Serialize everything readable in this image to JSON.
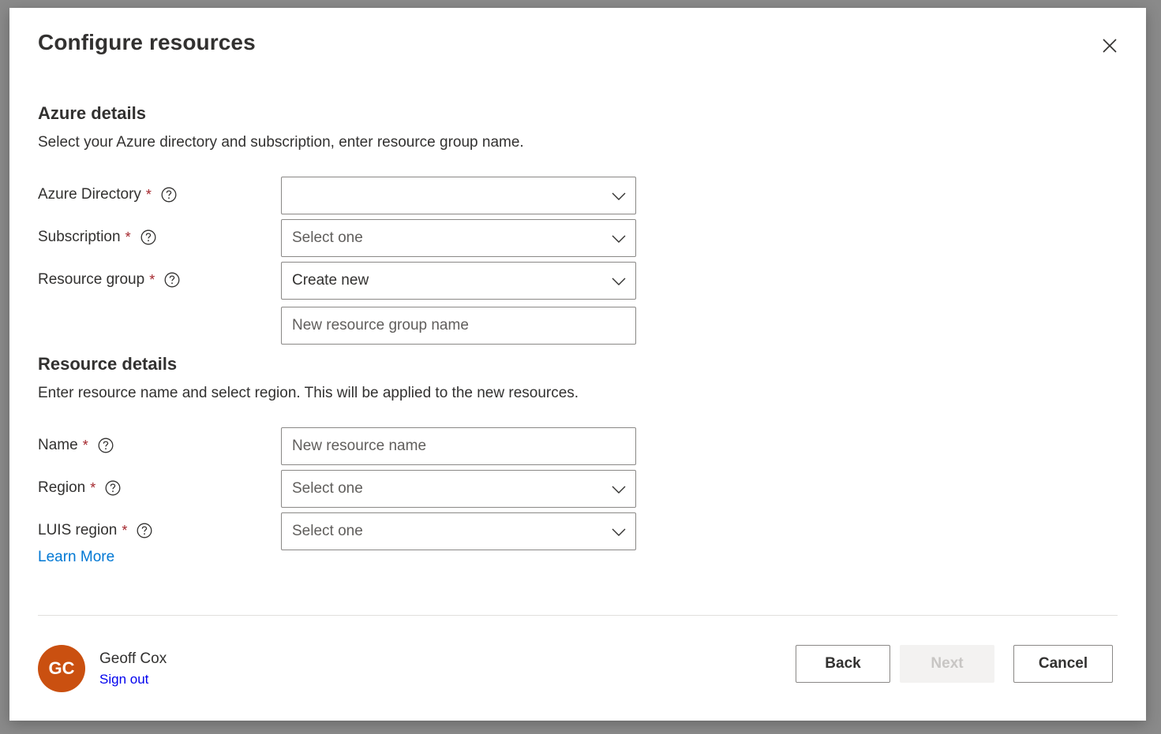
{
  "dialog": {
    "title": "Configure resources",
    "close_label": "Close"
  },
  "azure_details": {
    "title": "Azure details",
    "description": "Select your Azure directory and subscription, enter resource group name.",
    "fields": {
      "directory": {
        "label": "Azure Directory",
        "required": "*",
        "value": ""
      },
      "subscription": {
        "label": "Subscription",
        "required": "*",
        "value": "Select one"
      },
      "resource_group": {
        "label": "Resource group",
        "required": "*",
        "value": "Create new"
      },
      "new_group_name": {
        "placeholder": "New resource group name",
        "value": ""
      }
    }
  },
  "resource_details": {
    "title": "Resource details",
    "description": "Enter resource name and select region. This will be applied to the new resources.",
    "fields": {
      "name": {
        "label": "Name",
        "required": "*",
        "placeholder": "New resource name",
        "value": ""
      },
      "region": {
        "label": "Region",
        "required": "*",
        "value": "Select one"
      },
      "luis_region": {
        "label": "LUIS region",
        "required": "*",
        "value": "Select one"
      }
    },
    "learn_more": "Learn More"
  },
  "footer": {
    "user": {
      "initials": "GC",
      "name": "Geoff Cox",
      "sign_out": "Sign out",
      "avatar_color": "#ca5010"
    },
    "buttons": {
      "back": "Back",
      "next": "Next",
      "cancel": "Cancel"
    }
  },
  "icons": {
    "close": "close-icon",
    "help": "help-circle-icon",
    "dropdown": "chevron-down-icon"
  }
}
